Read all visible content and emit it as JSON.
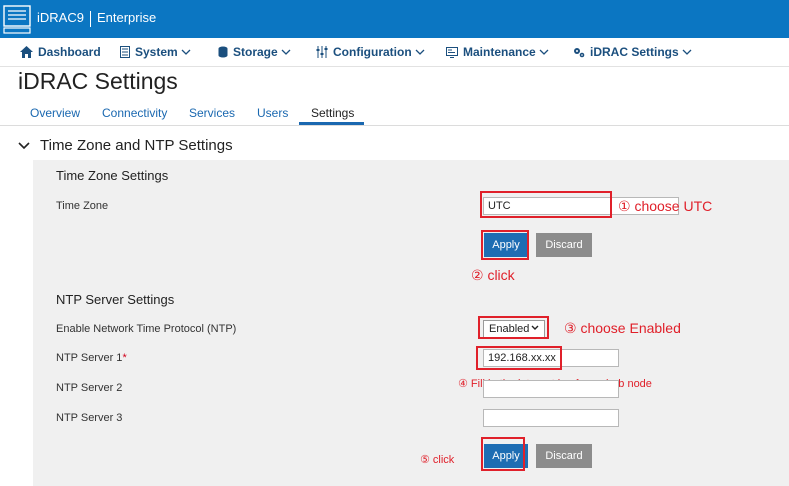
{
  "brand": {
    "product": "iDRAC9",
    "edition": "Enterprise"
  },
  "nav": {
    "dashboard": "Dashboard",
    "system": "System",
    "storage": "Storage",
    "configuration": "Configuration",
    "maintenance": "Maintenance",
    "idrac_settings": "iDRAC Settings"
  },
  "page": {
    "title": "iDRAC Settings"
  },
  "tabs": [
    "Overview",
    "Connectivity",
    "Services",
    "Users",
    "Settings"
  ],
  "section": {
    "title": "Time Zone and NTP Settings"
  },
  "timezone": {
    "subtitle": "Time Zone Settings",
    "label": "Time Zone",
    "value": "UTC",
    "apply": "Apply",
    "discard": "Discard"
  },
  "ntp": {
    "subtitle": "NTP Server Settings",
    "enable_label": "Enable Network Time Protocol (NTP)",
    "enable_value": "Enabled",
    "server1_label": "NTP Server 1",
    "server1_required": "*",
    "server1_value": "192.168.xx.xx",
    "server2_label": "NTP Server 2",
    "server2_value": "",
    "server3_label": "NTP Server 3",
    "server3_value": "",
    "apply": "Apply",
    "discard": "Discard"
  },
  "annotations": {
    "a1": "① choose UTC",
    "a2": "② click",
    "a3": "③ choose Enabled",
    "a4": "④ Fill in the intranet ip of your hub node",
    "a5": "⑤ click"
  },
  "colors": {
    "brand_bar": "#0b76c2",
    "nav_text": "#1b4f7e",
    "annotation": "#e0202a",
    "apply": "#1e6db3",
    "discard": "#8c8c8c"
  }
}
